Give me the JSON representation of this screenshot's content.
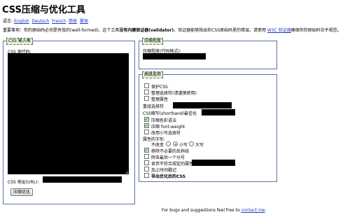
{
  "page_title": "CSS压缩与优化工具",
  "lang_bar": {
    "prefix": "语言:",
    "languages": [
      "English",
      "Deutsch",
      "French",
      "简体",
      "繁体"
    ]
  },
  "notice": {
    "part1": "重要事项：你的原始码必须是有效的(well-formed)。这个工具",
    "part2_bold": "没有内建验证器(validator)",
    "part3": "。验证器能够指出你CSS原始码里的错误。请使用",
    "link": "W3C 验证器",
    "part4": "确保你的原始码合乎规范。"
  },
  "input_panel": {
    "legend": "CSS 输入框",
    "source_label": "CSS 源代码:",
    "url_label": "CSS 地址(URL):",
    "submit_label": "压缩优化"
  },
  "level_panel": {
    "legend": "压缩程度",
    "label": "压缩程度(代码格式):"
  },
  "advanced_panel": {
    "legend": "高级选项",
    "options_top": [
      {
        "label": "保护CSS",
        "checked": false
      },
      {
        "label": "整理选择符(请谨慎使用)",
        "checked": false
      },
      {
        "label": "整理属性",
        "checked": false
      }
    ],
    "regroup_label": "重组选择符",
    "shorthand_label": "CSS缩写(shorthand)最佳化",
    "options_mid": [
      {
        "label": "压缩色彩语法",
        "checked": true
      },
      {
        "label": "压缩 font-weight",
        "checked": true
      },
      {
        "label": "改用小写选择符",
        "checked": false
      }
    ],
    "case_label": "属性的字形:",
    "case_options": [
      {
        "label": "不改变",
        "checked": false
      },
      {
        "label": "小写",
        "checked": true
      },
      {
        "label": "大写",
        "checked": false
      }
    ],
    "options_bottom": [
      {
        "label": "移除不必要的反斜线",
        "checked": true
      },
      {
        "label": "除去最后一个分号",
        "checked": false
      },
      {
        "label": "舍弃不符合规定的属性",
        "checked": false
      },
      {
        "label": "加上时间戳记",
        "checked": false
      },
      {
        "label": "导出优化后的CSS",
        "checked": false
      }
    ]
  },
  "footer": {
    "text": "For bugs and suggestions feel free to",
    "link": "contact me",
    "suffix": "."
  }
}
